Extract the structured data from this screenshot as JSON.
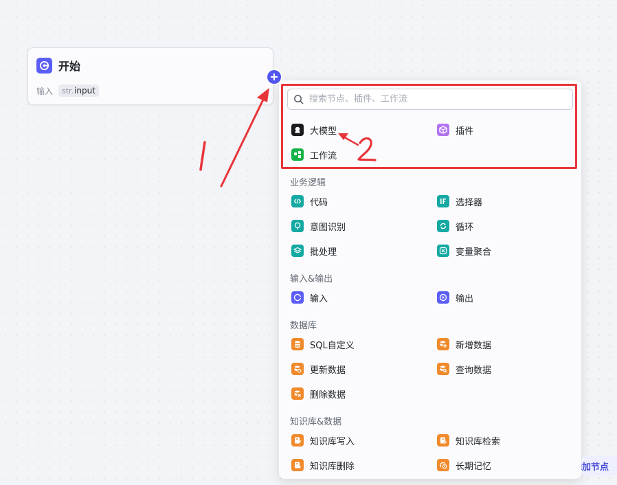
{
  "start_node": {
    "title": "开始",
    "input_label": "输入",
    "param_type": "str.",
    "param_name": "input"
  },
  "panel": {
    "search_placeholder": "搜索节点、插件、工作流",
    "top_items": [
      "大模型",
      "插件",
      "工作流"
    ],
    "sections": [
      {
        "title": "业务逻辑",
        "items": [
          "代码",
          "选择器",
          "意图识别",
          "循环",
          "批处理",
          "变量聚合"
        ]
      },
      {
        "title": "输入&输出",
        "items": [
          "输入",
          "输出"
        ]
      },
      {
        "title": "数据库",
        "items": [
          "SQL自定义",
          "新增数据",
          "更新数据",
          "查询数据",
          "删除数据"
        ]
      },
      {
        "title": "知识库&数据",
        "items": [
          "知识库写入",
          "知识库检索",
          "知识库删除",
          "长期记忆"
        ]
      }
    ]
  },
  "add_node_label": "添加节点",
  "annotations": {
    "step1": "1",
    "step2": "2",
    "color": "#e8353a"
  },
  "colors": {
    "accent": "#5b5ef5",
    "highlight_border": "#e8353a"
  }
}
